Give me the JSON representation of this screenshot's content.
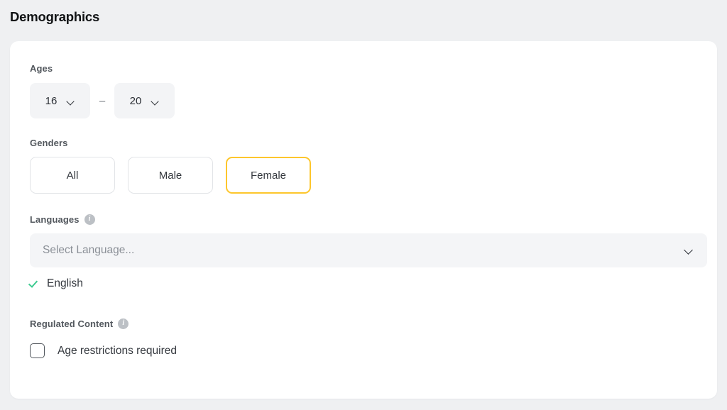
{
  "page": {
    "title": "Demographics",
    "background_color": "#eff0f2",
    "card_color": "#ffffff",
    "accent_color": "#fdc62c",
    "check_color": "#3ecb91"
  },
  "ages": {
    "label": "Ages",
    "min": {
      "value": "16",
      "icon": "chevron-down-icon"
    },
    "separator": "–",
    "max": {
      "value": "20",
      "icon": "chevron-down-icon"
    }
  },
  "genders": {
    "label": "Genders",
    "options": [
      {
        "label": "All",
        "selected": false
      },
      {
        "label": "Male",
        "selected": false
      },
      {
        "label": "Female",
        "selected": true
      }
    ]
  },
  "languages": {
    "label": "Languages",
    "info_icon": "info-icon",
    "info_glyph": "i",
    "select": {
      "placeholder": "Select Language...",
      "value": "",
      "icon": "chevron-down-icon"
    },
    "selected": [
      {
        "label": "English",
        "icon": "check-icon"
      }
    ]
  },
  "regulated_content": {
    "label": "Regulated Content",
    "info_icon": "info-icon",
    "info_glyph": "i",
    "checkbox": {
      "label": "Age restrictions required",
      "checked": false
    }
  }
}
